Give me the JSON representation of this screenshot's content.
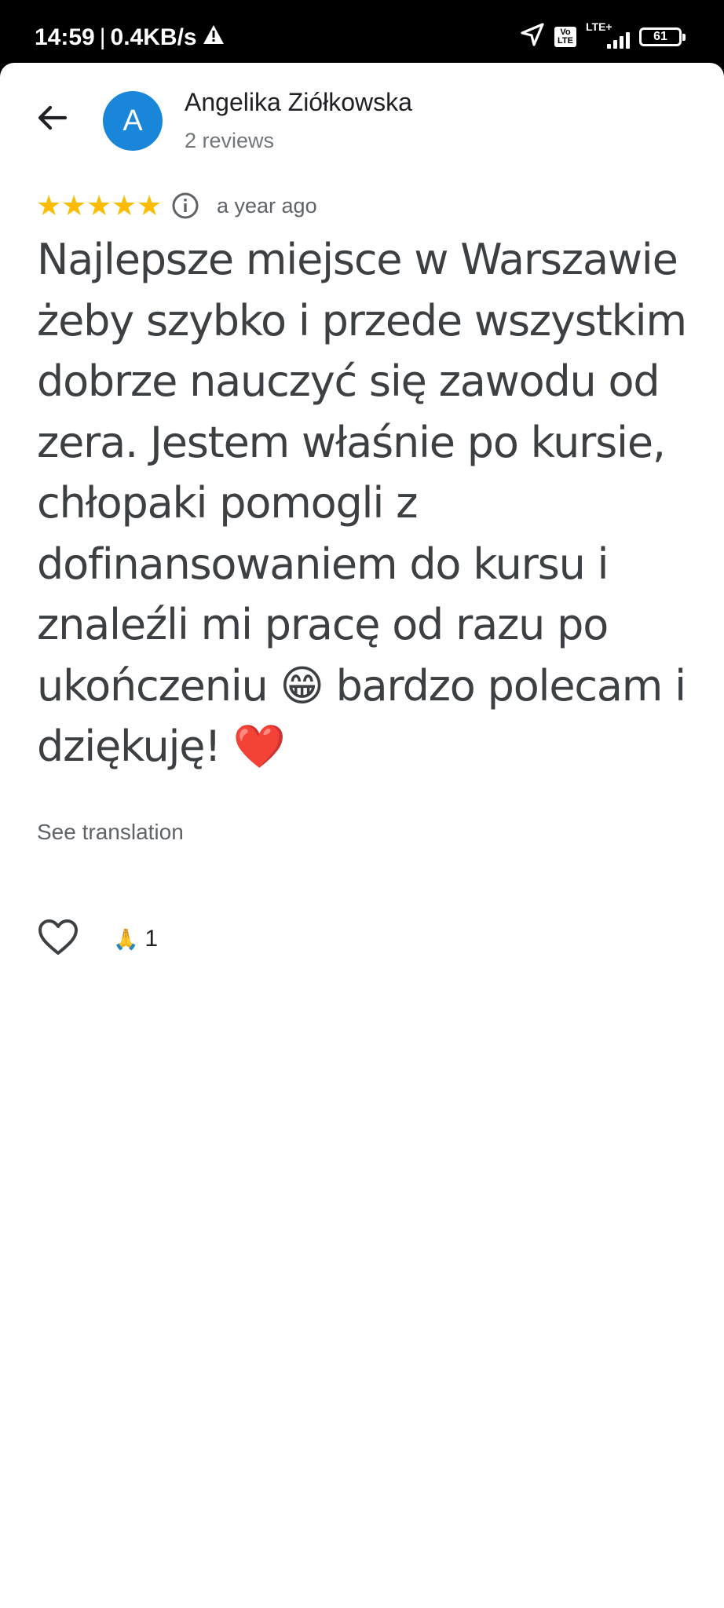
{
  "status_bar": {
    "time": "14:59",
    "separator": "|",
    "speed": "0.4KB/s",
    "warning_icon": "warning-triangle-icon",
    "location_icon": "navigation-arrow-icon",
    "volte_label_top": "Vo",
    "volte_label_bottom": "LTE",
    "network_label": "LTE+",
    "battery_level": "61"
  },
  "header": {
    "back_icon": "arrow-back-icon",
    "avatar_letter": "A",
    "avatar_color": "#1a86d9",
    "author_name": "Angelika Ziółkowska",
    "review_count": "2 reviews"
  },
  "review": {
    "rating": 5,
    "star_glyph": "★",
    "star_color": "#fbbc04",
    "info_icon": "info-circle-icon",
    "time_ago": "a year ago",
    "text": "Najlepsze miejsce w Warszawie żeby szybko i przede wszystkim dobrze nauczyć się zawodu od zera. Jestem właśnie po kursie, chłopaki pomogli z dofinansowaniem do kursu i znaleźli mi pracę od razu po ukończeniu 😁 bardzo polecam i dziękuję! ❤️",
    "see_translation": "See translation"
  },
  "actions": {
    "like_icon": "heart-outline-icon",
    "reaction_emoji": "🙏",
    "reaction_count": "1"
  }
}
